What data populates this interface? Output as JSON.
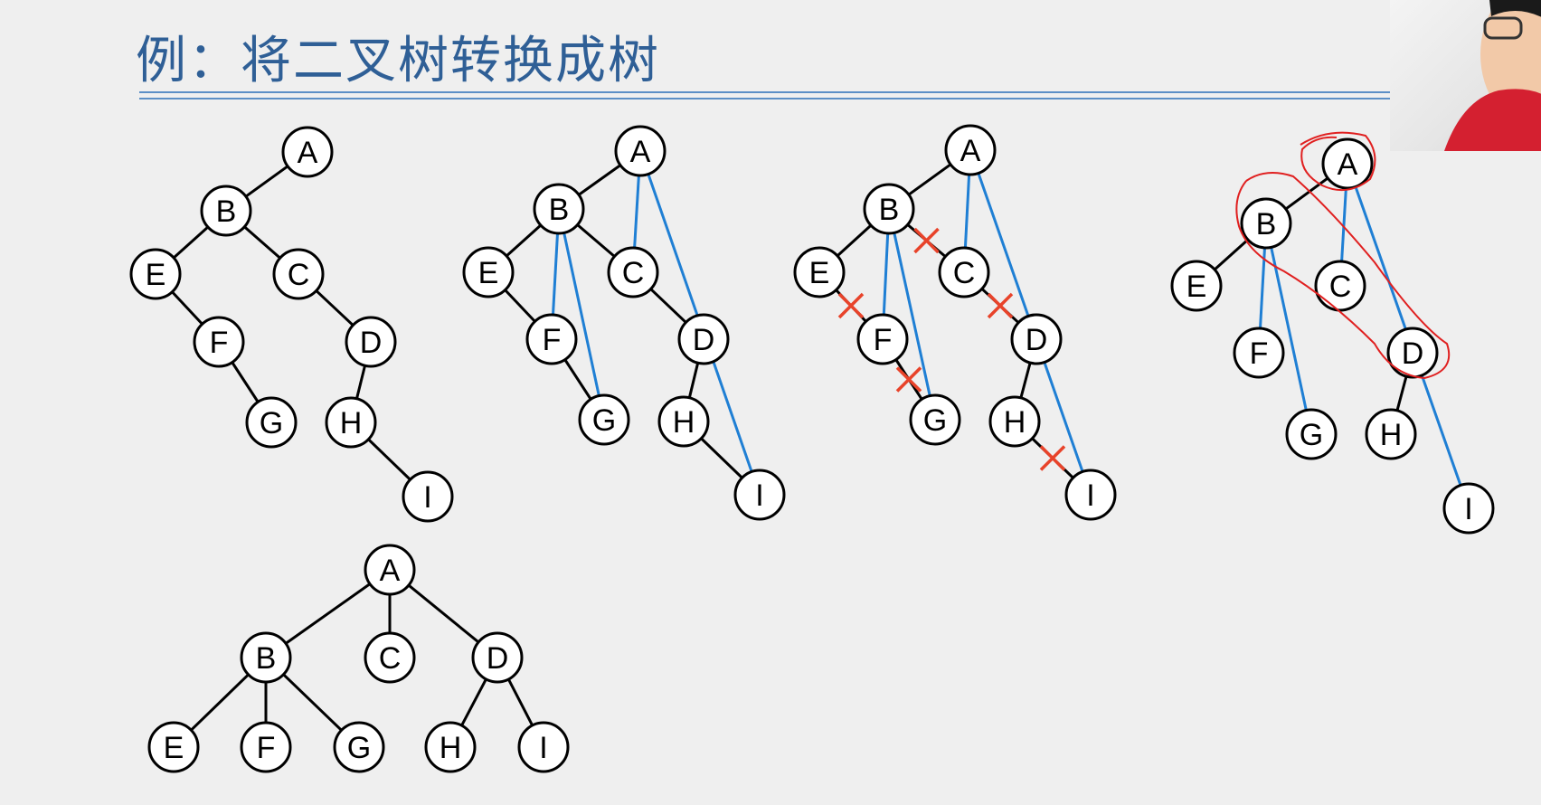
{
  "title": "例：将二叉树转换成树",
  "colors": {
    "title": "#2f5f96",
    "rule": "#5b8fc6",
    "edge": "#000000",
    "added_edge": "#1f7fd4",
    "cut_mark": "#e8432a",
    "annotation": "#e02020",
    "node_fill": "#ffffff"
  },
  "diagrams": [
    {
      "id": "binary-tree",
      "nodes": [
        {
          "label": "A"
        },
        {
          "label": "B"
        },
        {
          "label": "C"
        },
        {
          "label": "D"
        },
        {
          "label": "E"
        },
        {
          "label": "F"
        },
        {
          "label": "G"
        },
        {
          "label": "H"
        },
        {
          "label": "I"
        }
      ],
      "edges": [
        [
          "A",
          "B"
        ],
        [
          "B",
          "E"
        ],
        [
          "B",
          "C"
        ],
        [
          "E",
          "F"
        ],
        [
          "F",
          "G"
        ],
        [
          "C",
          "D"
        ],
        [
          "D",
          "H"
        ],
        [
          "H",
          "I"
        ]
      ],
      "added_edges": [],
      "cut_edges": []
    },
    {
      "id": "step1-add-lines",
      "nodes": [
        {
          "label": "A"
        },
        {
          "label": "B"
        },
        {
          "label": "C"
        },
        {
          "label": "D"
        },
        {
          "label": "E"
        },
        {
          "label": "F"
        },
        {
          "label": "G"
        },
        {
          "label": "H"
        },
        {
          "label": "I"
        }
      ],
      "edges": [
        [
          "A",
          "B"
        ],
        [
          "B",
          "E"
        ],
        [
          "B",
          "C"
        ],
        [
          "E",
          "F"
        ],
        [
          "F",
          "G"
        ],
        [
          "C",
          "D"
        ],
        [
          "D",
          "H"
        ],
        [
          "H",
          "I"
        ]
      ],
      "added_edges": [
        [
          "A",
          "C"
        ],
        [
          "A",
          "I"
        ],
        [
          "B",
          "F"
        ],
        [
          "B",
          "G"
        ]
      ],
      "cut_edges": []
    },
    {
      "id": "step2-cut-lines",
      "nodes": [
        {
          "label": "A"
        },
        {
          "label": "B"
        },
        {
          "label": "C"
        },
        {
          "label": "D"
        },
        {
          "label": "E"
        },
        {
          "label": "F"
        },
        {
          "label": "G"
        },
        {
          "label": "H"
        },
        {
          "label": "I"
        }
      ],
      "edges": [
        [
          "A",
          "B"
        ],
        [
          "B",
          "E"
        ],
        [
          "B",
          "C"
        ],
        [
          "E",
          "F"
        ],
        [
          "F",
          "G"
        ],
        [
          "C",
          "D"
        ],
        [
          "D",
          "H"
        ],
        [
          "H",
          "I"
        ]
      ],
      "added_edges": [
        [
          "A",
          "C"
        ],
        [
          "A",
          "I"
        ],
        [
          "B",
          "F"
        ],
        [
          "B",
          "G"
        ]
      ],
      "cut_edges": [
        [
          "B",
          "C"
        ],
        [
          "E",
          "F"
        ],
        [
          "F",
          "G"
        ],
        [
          "C",
          "D"
        ],
        [
          "H",
          "I"
        ]
      ]
    },
    {
      "id": "step3-rearrange",
      "nodes": [
        {
          "label": "A"
        },
        {
          "label": "B"
        },
        {
          "label": "C"
        },
        {
          "label": "D"
        },
        {
          "label": "E"
        },
        {
          "label": "F"
        },
        {
          "label": "G"
        },
        {
          "label": "H"
        },
        {
          "label": "I"
        }
      ],
      "edges": [
        [
          "A",
          "B"
        ],
        [
          "B",
          "E"
        ],
        [
          "D",
          "H"
        ]
      ],
      "added_edges": [
        [
          "A",
          "C"
        ],
        [
          "A",
          "I"
        ],
        [
          "B",
          "F"
        ],
        [
          "B",
          "G"
        ]
      ],
      "cut_edges": []
    },
    {
      "id": "result-tree",
      "nodes": [
        {
          "label": "A"
        },
        {
          "label": "B"
        },
        {
          "label": "C"
        },
        {
          "label": "D"
        },
        {
          "label": "E"
        },
        {
          "label": "F"
        },
        {
          "label": "G"
        },
        {
          "label": "H"
        },
        {
          "label": "I"
        }
      ],
      "edges": [
        [
          "A",
          "B"
        ],
        [
          "A",
          "C"
        ],
        [
          "A",
          "D"
        ],
        [
          "B",
          "E"
        ],
        [
          "B",
          "F"
        ],
        [
          "B",
          "G"
        ],
        [
          "D",
          "H"
        ],
        [
          "D",
          "I"
        ]
      ],
      "added_edges": [],
      "cut_edges": []
    }
  ]
}
